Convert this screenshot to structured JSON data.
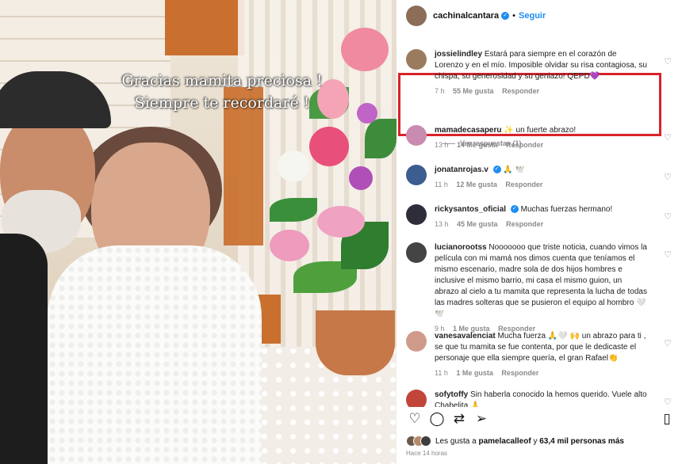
{
  "photo": {
    "caption": "Gracias mamita preciosa !\nSiempre te recordaré !"
  },
  "header": {
    "username": "cachinalcantara",
    "separator": "•",
    "follow_label": "Seguir"
  },
  "comments": [
    {
      "user": "jossielindley",
      "text": "Estará para siempre en el corazón de Lorenzo y en el mío. Imposible olvidar su risa contagiosa, su chispa, su generosidad y su geniazo! QEPD💜",
      "time": "7 h",
      "likes": "55 Me gusta",
      "reply": "Responder",
      "avatar_color": "#9a7b5e",
      "verified": false
    },
    {
      "user": "mamadecasaperu",
      "text": "✨ un fuerte abrazo!",
      "time": "13 h",
      "likes": "14 Me gusta",
      "reply": "Responder",
      "avatar_color": "#c98bb0",
      "verified": false
    },
    {
      "user": "jonatanrojas.v",
      "text": "🙏 🕊️",
      "time": "11 h",
      "likes": "12 Me gusta",
      "reply": "Responder",
      "avatar_color": "#3b5d8f",
      "verified": true
    },
    {
      "user": "rickysantos_oficial",
      "text": "Muchas fuerzas hermano!",
      "time": "13 h",
      "likes": "45 Me gusta",
      "reply": "Responder",
      "avatar_color": "#2e2e3a",
      "verified": true
    },
    {
      "user": "lucianorootss",
      "text": "Nooooooo que triste noticia, cuando vimos la película con mi mamá nos dimos cuenta que teníamos el mismo escenario, madre sola de dos hijos hombres e inclusive el mismo barrio, mi casa el mismo guion, un abrazo al cielo a tu mamita que representa la lucha de todas las madres solteras que se pusieron el equipo al hombro 🤍 🕊️",
      "time": "9 h",
      "likes": "1 Me gusta",
      "reply": "Responder",
      "avatar_color": "#444444",
      "verified": false
    },
    {
      "user": "vanesavalenciat",
      "text": "Mucha fuerza 🙏🤍 🙌 un abrazo para ti , se que tu mamita se fue contenta, por que le dedicaste el personaje que ella siempre quería, el gran Rafael👏",
      "time": "11 h",
      "likes": "1 Me gusta",
      "reply": "Responder",
      "avatar_color": "#d09a8a",
      "verified": false
    },
    {
      "user": "sofytoffy",
      "text": "Sin haberla conocido la hemos querido. Vuele alto Chabelita 🙏",
      "time": "",
      "likes": "",
      "reply": "",
      "avatar_color": "#c2453a",
      "verified": false
    }
  ],
  "replies_link": "Ver respuestas (1)",
  "actions": {
    "like_icon": "heart-icon",
    "comment_icon": "comment-icon",
    "repost_icon": "repost-icon",
    "share_icon": "share-icon",
    "save_icon": "bookmark-icon"
  },
  "likes_line": {
    "prefix": "Les gusta a",
    "user": "pamelacalleof",
    "middle": "y",
    "count": "63,4 mil personas más"
  },
  "posted_ago": "Hace 14 horas",
  "colors": {
    "highlight_border": "#d8232a",
    "accent": "#1d8df0"
  }
}
